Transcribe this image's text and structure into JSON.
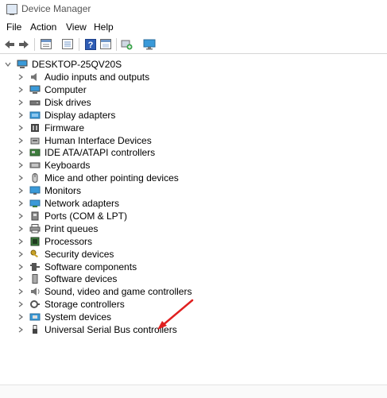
{
  "window": {
    "title": "Device Manager"
  },
  "menu": [
    "File",
    "Action",
    "View",
    "Help"
  ],
  "toolbar": [
    "back-icon",
    "forward-icon",
    "properties-icon",
    "list-icon",
    "help-icon",
    "details-icon",
    "scan-hardware-icon",
    "monitor-icon"
  ],
  "tree": {
    "root": "DESKTOP-25QV20S",
    "items": [
      {
        "label": "Audio inputs and outputs",
        "icon": "speaker-icon"
      },
      {
        "label": "Computer",
        "icon": "computer-icon"
      },
      {
        "label": "Disk drives",
        "icon": "disk-drive-icon"
      },
      {
        "label": "Display adapters",
        "icon": "display-adapter-icon"
      },
      {
        "label": "Firmware",
        "icon": "firmware-icon"
      },
      {
        "label": "Human Interface Devices",
        "icon": "hid-icon"
      },
      {
        "label": "IDE ATA/ATAPI controllers",
        "icon": "ide-controller-icon"
      },
      {
        "label": "Keyboards",
        "icon": "keyboard-icon"
      },
      {
        "label": "Mice and other pointing devices",
        "icon": "mouse-icon"
      },
      {
        "label": "Monitors",
        "icon": "monitor-icon"
      },
      {
        "label": "Network adapters",
        "icon": "network-adapter-icon"
      },
      {
        "label": "Ports (COM & LPT)",
        "icon": "port-icon"
      },
      {
        "label": "Print queues",
        "icon": "printer-icon"
      },
      {
        "label": "Processors",
        "icon": "processor-icon"
      },
      {
        "label": "Security devices",
        "icon": "security-key-icon"
      },
      {
        "label": "Software components",
        "icon": "software-component-icon"
      },
      {
        "label": "Software devices",
        "icon": "software-device-icon"
      },
      {
        "label": "Sound, video and game controllers",
        "icon": "sound-icon"
      },
      {
        "label": "Storage controllers",
        "icon": "storage-controller-icon"
      },
      {
        "label": "System devices",
        "icon": "system-devices-icon"
      },
      {
        "label": "Universal Serial Bus controllers",
        "icon": "usb-icon"
      }
    ]
  },
  "annotation": {
    "icon": "red-arrow-icon",
    "color": "#e02020"
  }
}
